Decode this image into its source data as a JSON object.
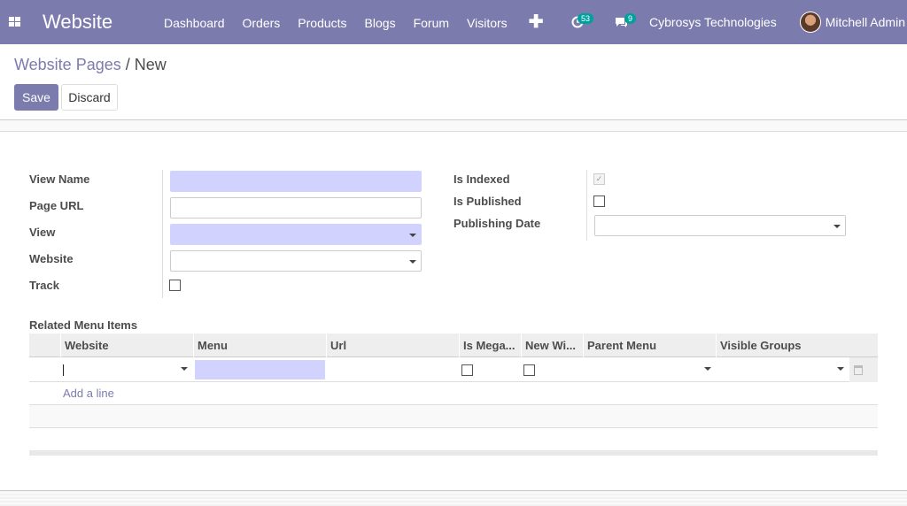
{
  "navbar": {
    "brand": "Website",
    "menu": [
      "Dashboard",
      "Orders",
      "Products",
      "Blogs",
      "Forum",
      "Visitors"
    ],
    "plus": "✚",
    "activity_badge": "53",
    "messages_badge": "9",
    "company": "Cybrosys Technologies",
    "user": "Mitchell Admin"
  },
  "breadcrumb": {
    "parent": "Website Pages",
    "separator": " / ",
    "current": "New"
  },
  "buttons": {
    "save": "Save",
    "discard": "Discard"
  },
  "form": {
    "left_labels": [
      "View Name",
      "Page URL",
      "View",
      "Website",
      "Track"
    ],
    "right_labels": [
      "Is Indexed",
      "Is Published",
      "Publishing Date"
    ],
    "is_indexed": true,
    "is_published": false,
    "track": false
  },
  "related": {
    "title": "Related Menu Items",
    "columns": [
      "Website",
      "Menu",
      "Url",
      "Is Mega...",
      "New Wi...",
      "Parent Menu",
      "Visible Groups"
    ],
    "add_line": "Add a line"
  },
  "colors": {
    "primary": "#7c7bad",
    "required_field": "#d2d2ff",
    "badge": "#00a09d"
  }
}
